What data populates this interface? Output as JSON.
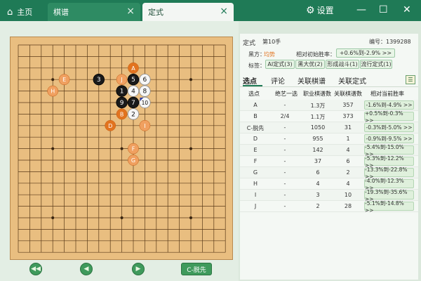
{
  "tabs": {
    "home": {
      "label": "主页"
    },
    "records": {
      "label": "棋谱"
    },
    "joseki": {
      "label": "定式"
    }
  },
  "settings_label": "设置",
  "colors": {
    "titlebar": "#1f7a56",
    "accent_orange": "#e2731f",
    "candidate_orange": "#f0a060"
  },
  "board": {
    "size": 19,
    "stones": [
      {
        "col": 7,
        "row": 3,
        "color": "black",
        "label": "3"
      },
      {
        "col": 9,
        "row": 4,
        "color": "black",
        "label": "1"
      },
      {
        "col": 10,
        "row": 3,
        "color": "black",
        "label": "5"
      },
      {
        "col": 9,
        "row": 5,
        "color": "black",
        "label": "9"
      },
      {
        "col": 10,
        "row": 5,
        "color": "black",
        "label": "7"
      },
      {
        "col": 11,
        "row": 3,
        "color": "white",
        "label": "6"
      },
      {
        "col": 10,
        "row": 4,
        "color": "white",
        "label": "4"
      },
      {
        "col": 11,
        "row": 4,
        "color": "white",
        "label": "8"
      },
      {
        "col": 11,
        "row": 5,
        "color": "white",
        "label": "10"
      },
      {
        "col": 10,
        "row": 6,
        "color": "white",
        "label": "2"
      }
    ],
    "candidates": [
      {
        "col": 10,
        "row": 2,
        "label": "A",
        "strong": true
      },
      {
        "col": 9,
        "row": 6,
        "label": "B",
        "strong": true
      },
      {
        "col": 8,
        "row": 7,
        "label": "D",
        "strong": true
      },
      {
        "col": 4,
        "row": 3,
        "label": "E",
        "strong": false
      },
      {
        "col": 10,
        "row": 9,
        "label": "F",
        "strong": false
      },
      {
        "col": 10,
        "row": 10,
        "label": "G",
        "strong": false
      },
      {
        "col": 3,
        "row": 4,
        "label": "H",
        "strong": false
      },
      {
        "col": 11,
        "row": 7,
        "label": "I",
        "strong": false
      },
      {
        "col": 9,
        "row": 3,
        "label": "J",
        "strong": false
      }
    ],
    "last_move": {
      "col": 11,
      "row": 5
    }
  },
  "controls": {
    "first": "◀◀",
    "prev": "◀",
    "next": "▶",
    "tenuki": "C-脱先"
  },
  "info": {
    "title": "定式",
    "move_num": "第10手",
    "id_text": "编号：1399288",
    "black_label": "黑方：",
    "black_value": "均势",
    "winrate_label": "相对初始胜率：",
    "winrate_value": "+0.6%到-2.9% >>",
    "tags_label": "标签：",
    "tags": [
      "AI定式(3)",
      "黑大优(2)",
      "形成战斗(1)",
      "流行定式(1)"
    ]
  },
  "subtabs": [
    "选点",
    "评论",
    "关联棋谱",
    "关联定式"
  ],
  "table": {
    "headers": [
      "选点",
      "绝艺一选",
      "职业棋谱数",
      "关联棋谱数",
      "相对当前胜率"
    ],
    "rows": [
      {
        "point": "A",
        "top": "-",
        "pro": "1.3万",
        "rel": "357",
        "wr": "-1.6%到-4.9% >>"
      },
      {
        "point": "B",
        "top": "2/4",
        "pro": "1.1万",
        "rel": "373",
        "wr": "+0.5%到-0.3% >>"
      },
      {
        "point": "C-脱先",
        "top": "-",
        "pro": "1050",
        "rel": "31",
        "wr": "-0.3%到-5.0% >>"
      },
      {
        "point": "D",
        "top": "-",
        "pro": "955",
        "rel": "1",
        "wr": "-0.9%到-9.5% >>"
      },
      {
        "point": "E",
        "top": "-",
        "pro": "142",
        "rel": "4",
        "wr": "-5.4%到-15.0% >>"
      },
      {
        "point": "F",
        "top": "-",
        "pro": "37",
        "rel": "6",
        "wr": "-5.3%到-12.2% >>"
      },
      {
        "point": "G",
        "top": "-",
        "pro": "6",
        "rel": "2",
        "wr": "-13.3%到-22.8% >>"
      },
      {
        "point": "H",
        "top": "-",
        "pro": "4",
        "rel": "4",
        "wr": "-4.0%到-12.3% >>"
      },
      {
        "point": "I",
        "top": "-",
        "pro": "3",
        "rel": "10",
        "wr": "-19.3%到-35.6% >>"
      },
      {
        "point": "J",
        "top": "-",
        "pro": "2",
        "rel": "28",
        "wr": "-5.1%到-14.8% >>"
      }
    ]
  }
}
